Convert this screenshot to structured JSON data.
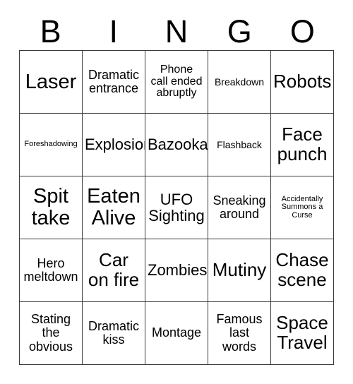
{
  "card": {
    "title": "BINGO",
    "header_letters": [
      "B",
      "I",
      "N",
      "G",
      "O"
    ],
    "grid_size": "5x5",
    "colors": {
      "background": "#ffffff",
      "text": "#000000",
      "border": "#3a3a3a"
    },
    "rows": [
      [
        {
          "text": "Laser",
          "size": "xxl"
        },
        {
          "text": "Dramatic\nentrance",
          "size": "m"
        },
        {
          "text": "Phone\ncall ended\nabruptly",
          "size": "s"
        },
        {
          "text": "Breakdown",
          "size": "xs"
        },
        {
          "text": "Robots",
          "size": "xl"
        }
      ],
      [
        {
          "text": "Foreshadowing",
          "size": "xxs"
        },
        {
          "text": "Explosion",
          "size": "l"
        },
        {
          "text": "Bazooka",
          "size": "l"
        },
        {
          "text": "Flashback",
          "size": "xs"
        },
        {
          "text": "Face\npunch",
          "size": "xl"
        }
      ],
      [
        {
          "text": "Spit\ntake",
          "size": "xxl"
        },
        {
          "text": "Eaten\nAlive",
          "size": "xxl"
        },
        {
          "text": "UFO\nSighting",
          "size": "l"
        },
        {
          "text": "Sneaking\naround",
          "size": "m"
        },
        {
          "text": "Accidentally\nSummons a\nCurse",
          "size": "xxs"
        }
      ],
      [
        {
          "text": "Hero\nmeltdown",
          "size": "m"
        },
        {
          "text": "Car\non fire",
          "size": "xl"
        },
        {
          "text": "Zombies",
          "size": "l"
        },
        {
          "text": "Mutiny",
          "size": "xl"
        },
        {
          "text": "Chase\nscene",
          "size": "xl"
        }
      ],
      [
        {
          "text": "Stating\nthe\nobvious",
          "size": "m"
        },
        {
          "text": "Dramatic\nkiss",
          "size": "m"
        },
        {
          "text": "Montage",
          "size": "m"
        },
        {
          "text": "Famous\nlast\nwords",
          "size": "m"
        },
        {
          "text": "Space\nTravel",
          "size": "xl"
        }
      ]
    ]
  }
}
